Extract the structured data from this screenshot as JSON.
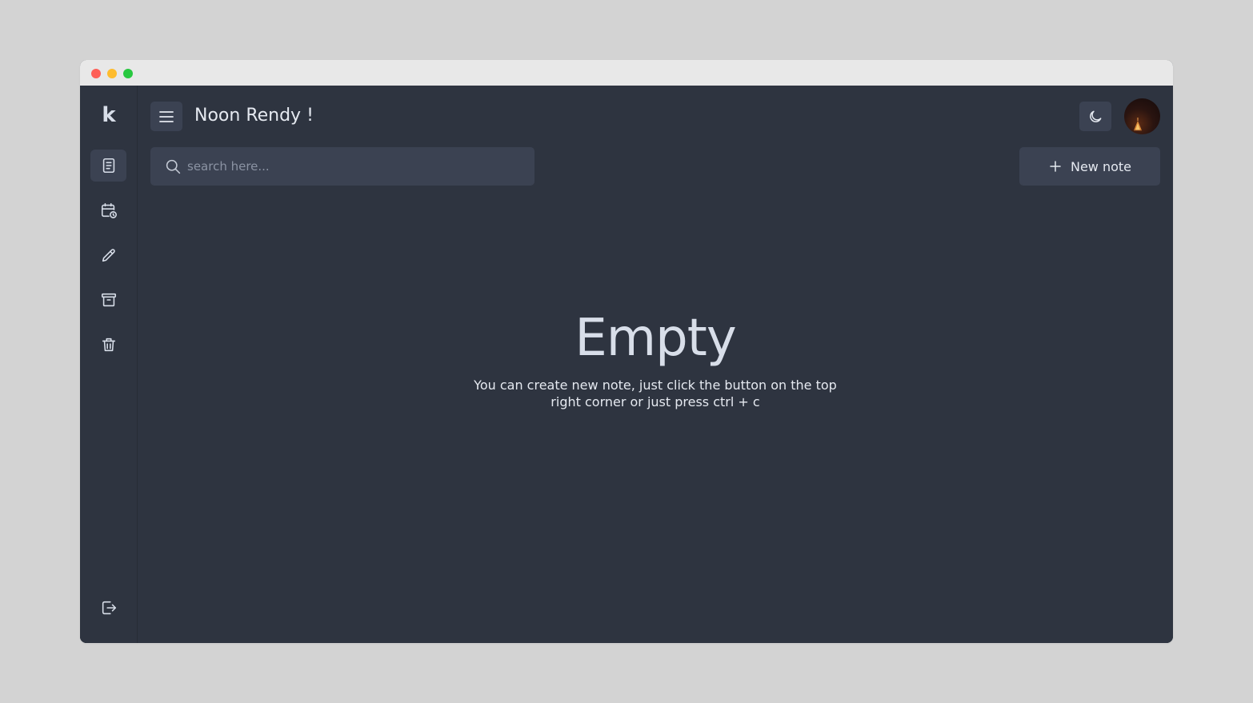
{
  "window": {
    "controls": [
      "close",
      "minimize",
      "maximize"
    ]
  },
  "sidebar": {
    "logo": "k",
    "items": [
      {
        "name": "notes",
        "icon": "document-icon",
        "active": true
      },
      {
        "name": "calendar",
        "icon": "calendar-clock-icon",
        "active": false
      },
      {
        "name": "edit",
        "icon": "pencil-icon",
        "active": false
      },
      {
        "name": "archive",
        "icon": "archive-icon",
        "active": false
      },
      {
        "name": "trash",
        "icon": "trash-icon",
        "active": false
      }
    ],
    "logout_icon": "logout-icon"
  },
  "header": {
    "menu_icon": "hamburger-icon",
    "greeting": "Noon Rendy !",
    "theme_icon": "moon-icon",
    "avatar": "user-avatar"
  },
  "search": {
    "placeholder": "search here...",
    "value": ""
  },
  "new_note": {
    "label": "New note",
    "icon": "plus-icon"
  },
  "empty_state": {
    "title": "Empty",
    "description": "You can create new note, just click the button on the top right corner or just press ctrl + c"
  },
  "colors": {
    "background": "#2e3440",
    "surface": "#3b4252",
    "text": "#e5e9f0",
    "muted": "#8b93a3",
    "page": "#d3d3d3"
  }
}
